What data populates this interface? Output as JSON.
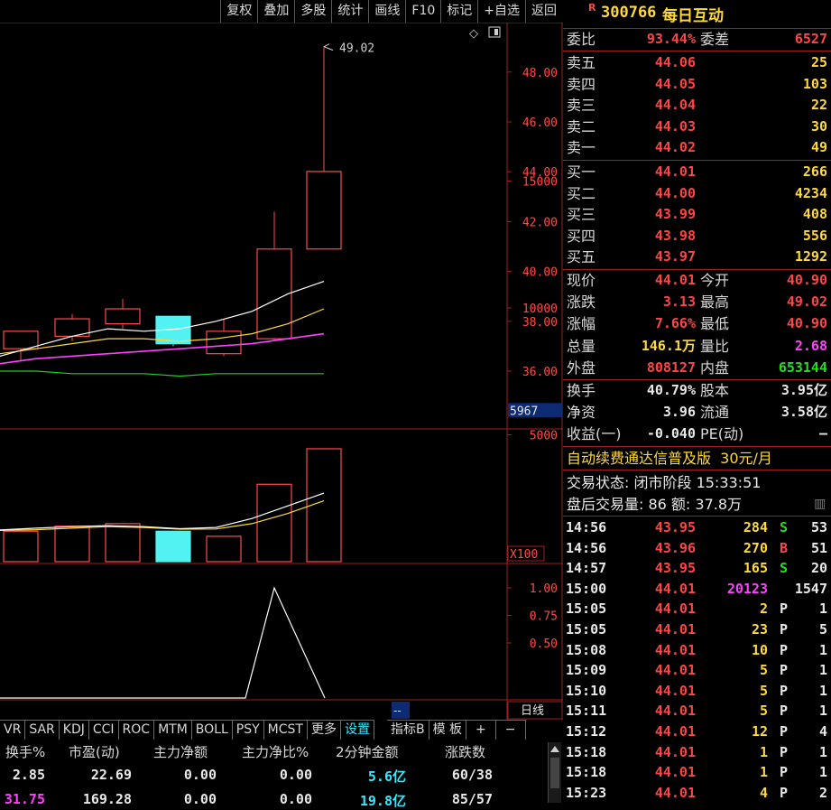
{
  "toolbar": {
    "items": [
      "复权",
      "叠加",
      "多股",
      "统计",
      "画线",
      "F10",
      "标记",
      "+自选",
      "返回"
    ]
  },
  "chart": {
    "price_axis": [
      "48.00",
      "46.00",
      "44.00",
      "42.00",
      "40.00",
      "38.00",
      "36.00"
    ],
    "high_label": "49.02",
    "volume_axis": [
      "15000",
      "10000",
      "5000"
    ],
    "volume_current": "5967",
    "volume_multiplier": "X100",
    "indicator_axis": [
      "1.00",
      "0.75",
      "0.50"
    ],
    "period_label": "日线",
    "corner_label": "--",
    "colors": {
      "up": "#ff4a4a",
      "down": "#52f2f2",
      "ma5": "#ffffff",
      "ma10": "#ffd83a",
      "ma20": "#ff40ff",
      "ma60": "#22cc22"
    }
  },
  "chart_data": {
    "type": "candlestick",
    "candles": [
      {
        "open": 36.9,
        "close": 37.6,
        "high": 37.6,
        "low": 36.4
      },
      {
        "open": 37.4,
        "close": 38.1,
        "high": 38.3,
        "low": 37.2
      },
      {
        "open": 37.9,
        "close": 38.5,
        "high": 38.9,
        "low": 37.7
      },
      {
        "open": 38.2,
        "close": 37.1,
        "high": 38.2,
        "low": 37.0
      },
      {
        "open": 36.7,
        "close": 37.6,
        "high": 38.1,
        "low": 36.6
      },
      {
        "open": 37.3,
        "close": 40.9,
        "high": 42.4,
        "low": 37.2
      },
      {
        "open": 40.9,
        "close": 44.01,
        "high": 49.02,
        "low": 40.9
      }
    ],
    "volume": [
      1200,
      1400,
      1500,
      1200,
      1000,
      3050,
      4450
    ],
    "ma5": [
      36.6,
      37.0,
      37.4,
      37.7,
      37.6,
      37.7,
      38.0,
      38.4,
      39.1,
      39.6
    ],
    "ma10": [
      36.7,
      36.9,
      37.1,
      37.3,
      37.3,
      37.2,
      37.3,
      37.5,
      37.9,
      38.5
    ],
    "ma20": [
      36.3,
      36.5,
      36.6,
      36.7,
      36.8,
      36.9,
      37.0,
      37.1,
      37.3,
      37.5
    ],
    "ma60": [
      36.0,
      36.0,
      35.9,
      35.9,
      35.9,
      35.8,
      35.9,
      35.9,
      35.9,
      35.9
    ],
    "vol_ma5": [
      1250,
      1320,
      1380,
      1420,
      1380,
      1300,
      1350,
      1700,
      2200,
      2700
    ],
    "vol_ma10": [
      1230,
      1260,
      1320,
      1380,
      1350,
      1280,
      1290,
      1500,
      1900,
      2400
    ],
    "indicator": [
      0,
      0,
      0,
      0,
      0,
      0,
      0,
      0,
      1.0,
      0
    ],
    "ylim_price": [
      35.4,
      49.8
    ]
  },
  "right": {
    "stock": {
      "badge": "R",
      "code": "300766",
      "name": "每日互动"
    },
    "weibi": {
      "label": "委比",
      "value": "93.44%",
      "label2": "委差",
      "value2": "6527"
    },
    "sells": [
      {
        "label": "卖五",
        "price": "44.06",
        "vol": "25"
      },
      {
        "label": "卖四",
        "price": "44.05",
        "vol": "103"
      },
      {
        "label": "卖三",
        "price": "44.04",
        "vol": "22"
      },
      {
        "label": "卖二",
        "price": "44.03",
        "vol": "30"
      },
      {
        "label": "卖一",
        "price": "44.02",
        "vol": "49"
      }
    ],
    "buys": [
      {
        "label": "买一",
        "price": "44.01",
        "vol": "266"
      },
      {
        "label": "买二",
        "price": "44.00",
        "vol": "4234"
      },
      {
        "label": "买三",
        "price": "43.99",
        "vol": "408"
      },
      {
        "label": "买四",
        "price": "43.98",
        "vol": "556"
      },
      {
        "label": "买五",
        "price": "43.97",
        "vol": "1292"
      }
    ],
    "quote": [
      {
        "l1": "现价",
        "v1": "44.01",
        "c1": "red",
        "l2": "今开",
        "v2": "40.90",
        "c2": "red"
      },
      {
        "l1": "涨跌",
        "v1": "3.13",
        "c1": "red",
        "l2": "最高",
        "v2": "49.02",
        "c2": "red"
      },
      {
        "l1": "涨幅",
        "v1": "7.66%",
        "c1": "red",
        "l2": "最低",
        "v2": "40.90",
        "c2": "red"
      },
      {
        "l1": "总量",
        "v1": "146.1万",
        "c1": "yel",
        "l2": "量比",
        "v2": "2.68",
        "c2": "mag"
      },
      {
        "l1": "外盘",
        "v1": "808127",
        "c1": "red",
        "l2": "内盘",
        "v2": "653144",
        "c2": "grn"
      }
    ],
    "fund": [
      {
        "l1": "换手",
        "v1": "40.79%",
        "l2": "股本",
        "v2": "3.95亿"
      },
      {
        "l1": "净资",
        "v1": "3.96",
        "l2": "流通",
        "v2": "3.58亿"
      },
      {
        "l1": "收益(一)",
        "v1": "-0.040",
        "l2": "PE(动)",
        "v2": "—"
      }
    ],
    "promo": "自动续费通达信普及版  30元/月",
    "status": "交易状态: 闭市阶段 15:33:51",
    "after": "盘后交易量: 86  额: 37.8万",
    "ticks": [
      {
        "t": "14:56",
        "p": "43.95",
        "v": "284",
        "vc": "yel",
        "bs": "S",
        "bc": "grn",
        "n": "53"
      },
      {
        "t": "14:56",
        "p": "43.96",
        "v": "270",
        "vc": "yel",
        "bs": "B",
        "bc": "red",
        "n": "51"
      },
      {
        "t": "14:57",
        "p": "43.95",
        "v": "165",
        "vc": "yel",
        "bs": "S",
        "bc": "grn",
        "n": "20"
      },
      {
        "t": "15:00",
        "p": "44.01",
        "v": "20123",
        "vc": "mag",
        "bs": "",
        "bc": "wht",
        "n": "1547"
      },
      {
        "t": "15:05",
        "p": "44.01",
        "v": "2",
        "vc": "yel",
        "bs": "P",
        "bc": "wht",
        "n": "1"
      },
      {
        "t": "15:05",
        "p": "44.01",
        "v": "23",
        "vc": "yel",
        "bs": "P",
        "bc": "wht",
        "n": "5"
      },
      {
        "t": "15:08",
        "p": "44.01",
        "v": "10",
        "vc": "yel",
        "bs": "P",
        "bc": "wht",
        "n": "1"
      },
      {
        "t": "15:09",
        "p": "44.01",
        "v": "5",
        "vc": "yel",
        "bs": "P",
        "bc": "wht",
        "n": "1"
      },
      {
        "t": "15:10",
        "p": "44.01",
        "v": "5",
        "vc": "yel",
        "bs": "P",
        "bc": "wht",
        "n": "1"
      },
      {
        "t": "15:11",
        "p": "44.01",
        "v": "5",
        "vc": "yel",
        "bs": "P",
        "bc": "wht",
        "n": "1"
      },
      {
        "t": "15:12",
        "p": "44.01",
        "v": "12",
        "vc": "yel",
        "bs": "P",
        "bc": "wht",
        "n": "4"
      },
      {
        "t": "15:18",
        "p": "44.01",
        "v": "1",
        "vc": "yel",
        "bs": "P",
        "bc": "wht",
        "n": "1"
      },
      {
        "t": "15:18",
        "p": "44.01",
        "v": "1",
        "vc": "yel",
        "bs": "P",
        "bc": "wht",
        "n": "1"
      },
      {
        "t": "15:23",
        "p": "44.01",
        "v": "4",
        "vc": "yel",
        "bs": "P",
        "bc": "wht",
        "n": "2"
      }
    ]
  },
  "indicator_tabs": [
    "VR",
    "SAR",
    "KDJ",
    "CCI",
    "ROC",
    "MTM",
    "BOLL",
    "PSY",
    "MCST",
    "更多",
    "设置",
    "指标B",
    "模 板",
    "+",
    "−"
  ],
  "table": {
    "headers": [
      "换手%",
      "市盈(动)",
      "主力净额",
      "主力净比%",
      "2分钟金额",
      "涨跌数"
    ],
    "rows": [
      [
        "2.85",
        "22.69",
        "0.00",
        "0.00",
        "5.6亿",
        "60/38"
      ],
      [
        "31.75",
        "169.28",
        "0.00",
        "0.00",
        "19.8亿",
        "85/57"
      ]
    ]
  }
}
